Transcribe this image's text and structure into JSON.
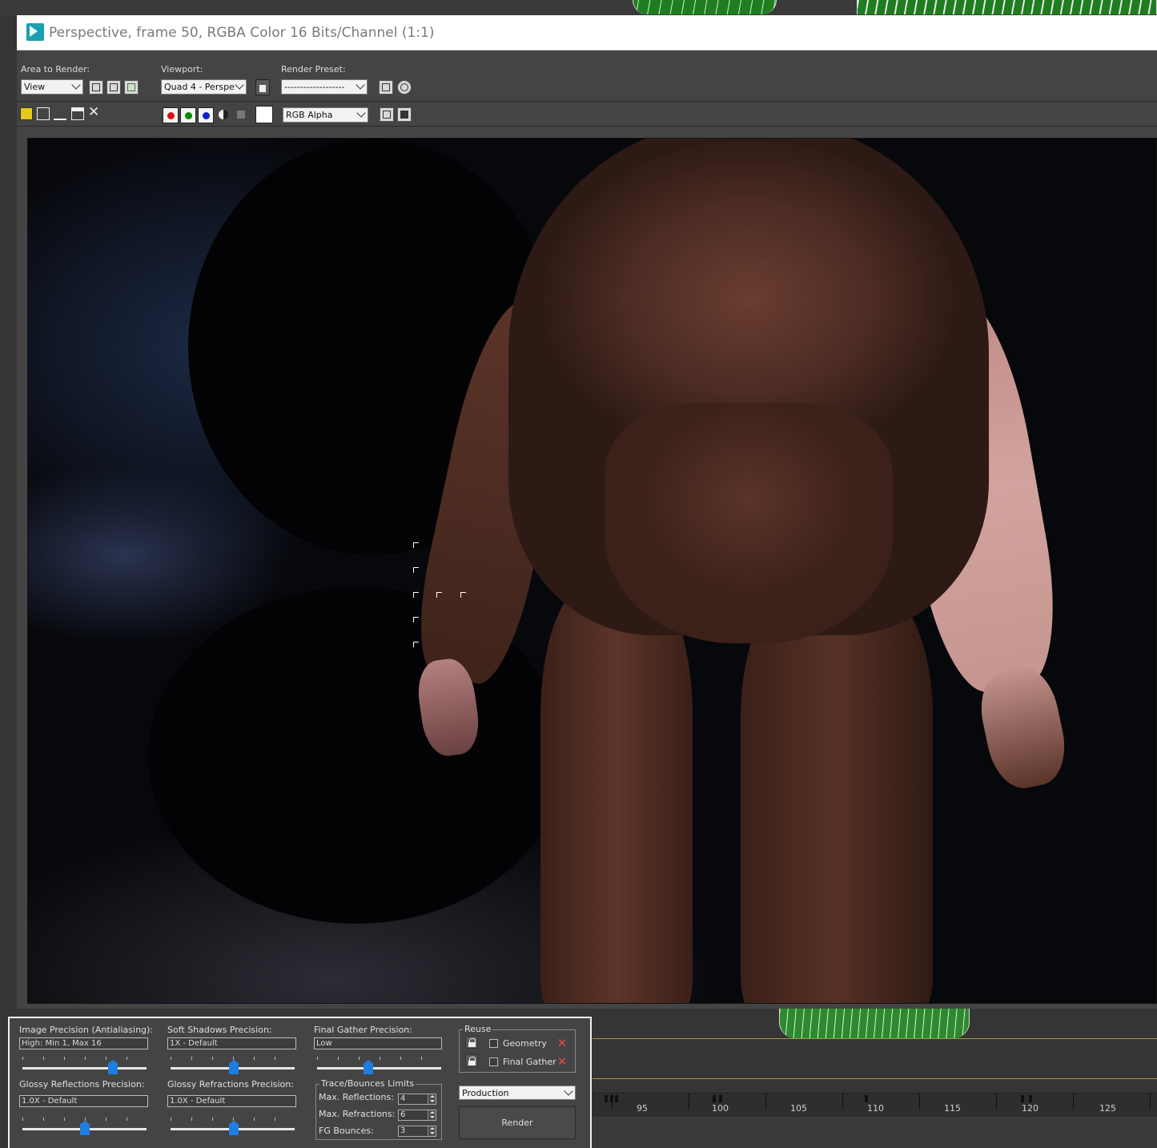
{
  "window": {
    "title": "Perspective, frame 50, RGBA Color 16 Bits/Channel (1:1)"
  },
  "toolbar": {
    "area_label": "Area to Render:",
    "area_value": "View",
    "viewport_label": "Viewport:",
    "viewport_value": "Quad 4 - Perspe",
    "preset_label": "Render Preset:",
    "preset_value": "-------------------",
    "channel_value": "RGB Alpha"
  },
  "settings": {
    "image_precision_label": "Image Precision (Antialiasing):",
    "image_precision_value": "High: Min 1, Max 16",
    "soft_shadows_label": "Soft Shadows Precision:",
    "soft_shadows_value": "1X - Default",
    "final_gather_label": "Final Gather Precision:",
    "final_gather_value": "Low",
    "glossy_reflections_label": "Glossy Reflections Precision:",
    "glossy_reflections_value": "1.0X - Default",
    "glossy_refractions_label": "Glossy Refractions Precision:",
    "glossy_refractions_value": "1.0X - Default",
    "trace_group_label": "Trace/Bounces Limits",
    "max_reflections_label": "Max. Reflections:",
    "max_reflections_value": "4",
    "max_refractions_label": "Max. Refractions:",
    "max_refractions_value": "6",
    "fg_bounces_label": "FG Bounces:",
    "fg_bounces_value": "3",
    "reuse_label": "Reuse",
    "geometry_label": "Geometry",
    "final_gather_reuse_label": "Final Gather",
    "mode_value": "Production",
    "render_label": "Render"
  },
  "timeline": {
    "labels": [
      "95",
      "100",
      "105",
      "110",
      "115",
      "120",
      "125"
    ]
  },
  "colors": {
    "accent": "#1e7de0",
    "red_channel": "#e01010",
    "green_channel": "#0a8a0a",
    "blue_channel": "#1020d0"
  }
}
